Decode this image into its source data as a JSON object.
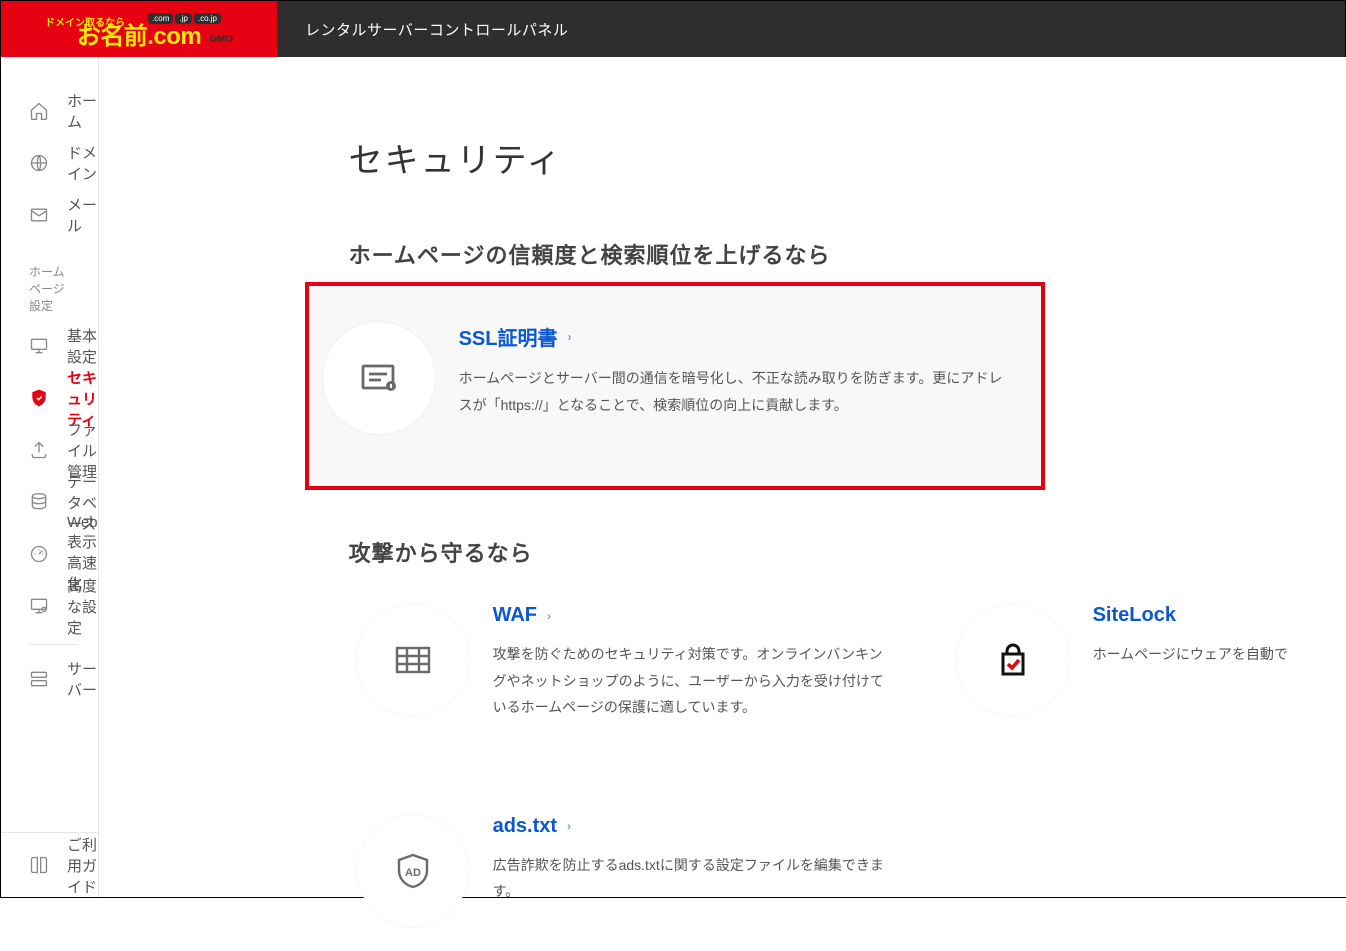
{
  "header": {
    "tagline": "ドメイン取るなら",
    "brand_main": "お名前",
    "brand_dot": ".com",
    "badges": [
      ".com",
      ".jp",
      ".co.jp"
    ],
    "gmo": "GMO",
    "title": "レンタルサーバーコントロールパネル"
  },
  "sidebar": {
    "top": [
      {
        "id": "home",
        "icon": "home",
        "label": "ホーム"
      },
      {
        "id": "domain",
        "icon": "globe",
        "label": "ドメイン"
      },
      {
        "id": "mail",
        "icon": "mail",
        "label": "メール"
      }
    ],
    "section_label": "ホームページ設定",
    "homepage": [
      {
        "id": "basic",
        "icon": "monitor",
        "label": "基本設定"
      },
      {
        "id": "security",
        "icon": "shield",
        "label": "セキュリティ",
        "active": true
      },
      {
        "id": "files",
        "icon": "upload",
        "label": "ファイル管理"
      },
      {
        "id": "db",
        "icon": "database",
        "label": "データベース"
      },
      {
        "id": "speed",
        "icon": "speed",
        "label": "Web表示高速化"
      },
      {
        "id": "advanced",
        "icon": "monitor2",
        "label": "高度な設定"
      }
    ],
    "lower": [
      {
        "id": "server",
        "icon": "server",
        "label": "サーバー"
      }
    ],
    "footer": {
      "id": "guide",
      "icon": "book",
      "label": "ご利用ガイド"
    }
  },
  "main": {
    "page_title": "セキュリティ",
    "section1": {
      "heading": "ホームページの信頼度と検索順位を上げるなら",
      "cards": [
        {
          "id": "ssl",
          "title": "SSL証明書",
          "desc": "ホームページとサーバー間の通信を暗号化し、不正な読み取りを防ぎます。更にアドレスが「https://」となることで、検索順位の向上に貢献します。",
          "highlight": true
        }
      ]
    },
    "section2": {
      "heading": "攻撃から守るなら",
      "cards": [
        {
          "id": "waf",
          "title": "WAF",
          "desc": "攻撃を防ぐためのセキュリティ対策です。オンラインバンキングやネットショップのように、ユーザーから入力を受け付けているホームページの保護に適しています。"
        },
        {
          "id": "sitelock",
          "title": "SiteLock",
          "desc": "ホームページにウェアを自動で"
        }
      ]
    },
    "section3": {
      "cards": [
        {
          "id": "adstxt",
          "title": "ads.txt",
          "desc": "広告詐欺を防止するads.txtに関する設定ファイルを編集できます。"
        }
      ]
    }
  }
}
